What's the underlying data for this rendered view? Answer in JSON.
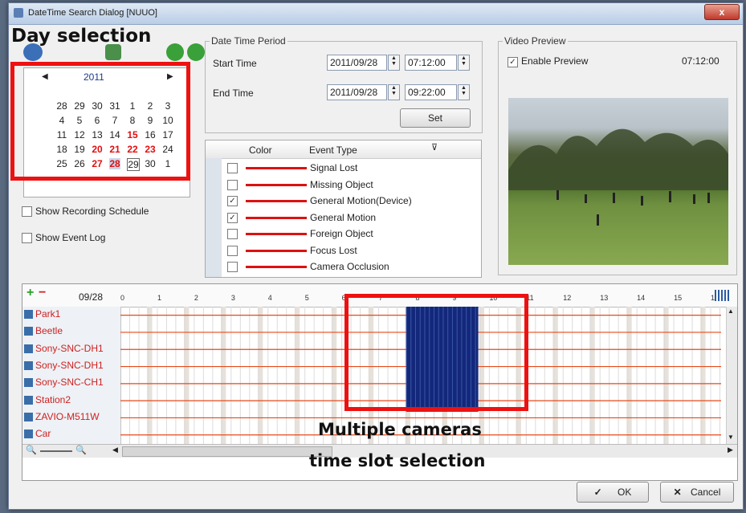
{
  "window": {
    "title": "DateTime Search Dialog [NUUO]",
    "close": "x"
  },
  "annotations": {
    "day_selection": "Day selection",
    "multi_cam": [
      "Multiple cameras",
      "time slot selection"
    ]
  },
  "calendar": {
    "month_label": "2011",
    "rows": [
      [
        "28",
        "29",
        "30",
        "31",
        "1",
        "2",
        "3"
      ],
      [
        "4",
        "5",
        "6",
        "7",
        "8",
        "9",
        "10"
      ],
      [
        "11",
        "12",
        "13",
        "14",
        "15",
        "16",
        "17"
      ],
      [
        "18",
        "19",
        "20",
        "21",
        "22",
        "23",
        "24"
      ],
      [
        "25",
        "26",
        "27",
        "28",
        "29",
        "30",
        "1"
      ]
    ],
    "red_days": [
      "15",
      "20",
      "21",
      "22",
      "23",
      "27",
      "28"
    ],
    "selected_day": "29"
  },
  "options": {
    "show_recording_schedule": "Show Recording Schedule",
    "show_event_log": "Show Event Log"
  },
  "datetime_period": {
    "group_label": "Date Time Period",
    "start_label": "Start Time",
    "start_date": "2011/09/28",
    "start_time": "07:12:00",
    "end_label": "End Time",
    "end_date": "2011/09/28",
    "end_time": "09:22:00",
    "set_button": "Set"
  },
  "events": {
    "col_color": "Color",
    "col_type": "Event Type",
    "items": [
      {
        "name": "Signal Lost",
        "checked": false
      },
      {
        "name": "Missing Object",
        "checked": false
      },
      {
        "name": "General Motion(Device)",
        "checked": true
      },
      {
        "name": "General Motion",
        "checked": true
      },
      {
        "name": "Foreign Object",
        "checked": false
      },
      {
        "name": "Focus Lost",
        "checked": false
      },
      {
        "name": "Camera Occlusion",
        "checked": false
      }
    ],
    "line_color": "#dd1111"
  },
  "preview": {
    "group_label": "Video Preview",
    "enable_label": "Enable Preview",
    "enable_checked": true,
    "time": "07:12:00"
  },
  "timeline": {
    "date": "09/28",
    "hours": [
      "0",
      "1",
      "2",
      "3",
      "4",
      "5",
      "6",
      "7",
      "8",
      "9",
      "10",
      "11",
      "12",
      "13",
      "14",
      "15",
      "16"
    ],
    "cameras": [
      "Park1",
      "Beetle",
      "Sony-SNC-DH1",
      "Sony-SNC-DH1",
      "Sony-SNC-CH1",
      "Station2",
      "ZAVIO-M511W",
      "Car"
    ],
    "selection_color": "#13287a"
  },
  "buttons": {
    "ok": "OK",
    "cancel": "Cancel"
  }
}
